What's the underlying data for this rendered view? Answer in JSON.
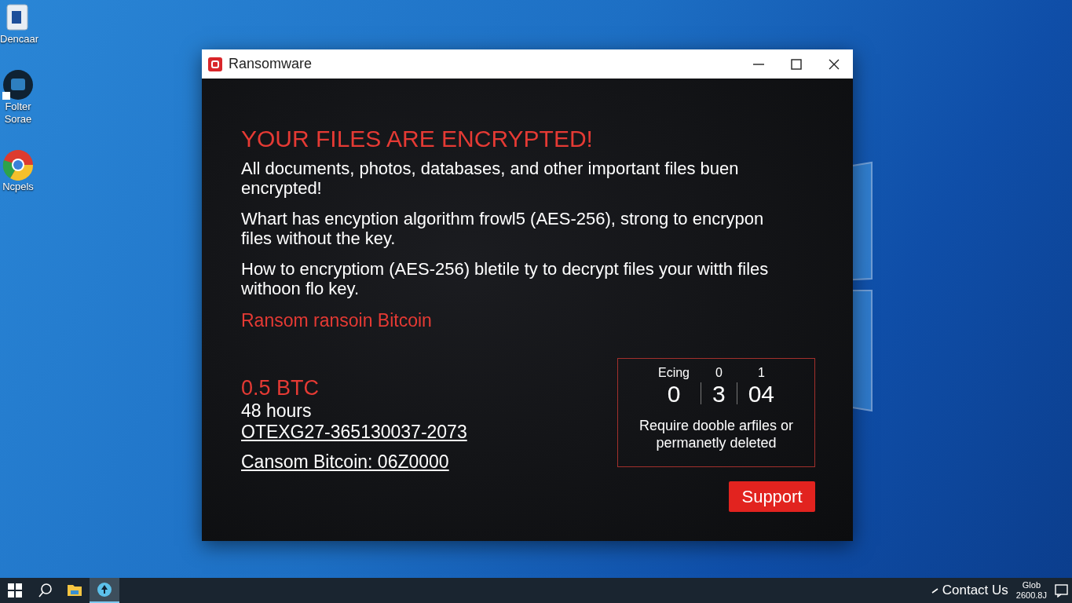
{
  "desktop_icons": [
    {
      "kind": "bin",
      "label": "Dencaar"
    },
    {
      "kind": "disc",
      "label": "Folter Sorae"
    },
    {
      "kind": "browser",
      "label": "Ncpels"
    }
  ],
  "window": {
    "title": "Ransomware",
    "heading": "YOUR FILES ARE ENCRYPTED!",
    "paragraphs": [
      "All documents, photos, databases, and other important files buen encrypted!",
      "Whart has encyption algorithm frowl5  (AES-256), strong to encrypon files without the key.",
      "How to encryptiom (AES-256) bletile ty to decrypt files your witth files withoon flo key."
    ],
    "subheading": "Ransom ransoin Bitcoin",
    "amount": "0.5 BTC",
    "deadline": "48 hours",
    "id_link": "OTEXG27-365130037-2073",
    "wallet_link": "Cansom Bitcoin: 06Z0000",
    "timer": {
      "columns": [
        {
          "label": "Ecing",
          "value": "0"
        },
        {
          "label": "0",
          "value": "3"
        },
        {
          "label": "1",
          "value": "04"
        }
      ],
      "note": "Require dooble arfiles or permanetly deleted"
    },
    "support_button": "Support"
  },
  "taskbar": {
    "items": [
      {
        "kind": "start",
        "selected": false
      },
      {
        "kind": "search",
        "selected": false
      },
      {
        "kind": "folder",
        "selected": false
      },
      {
        "kind": "app",
        "selected": true
      }
    ],
    "tray_link": "Contact Us",
    "clock_top": "Glob",
    "clock_bottom": "2600.8J"
  }
}
